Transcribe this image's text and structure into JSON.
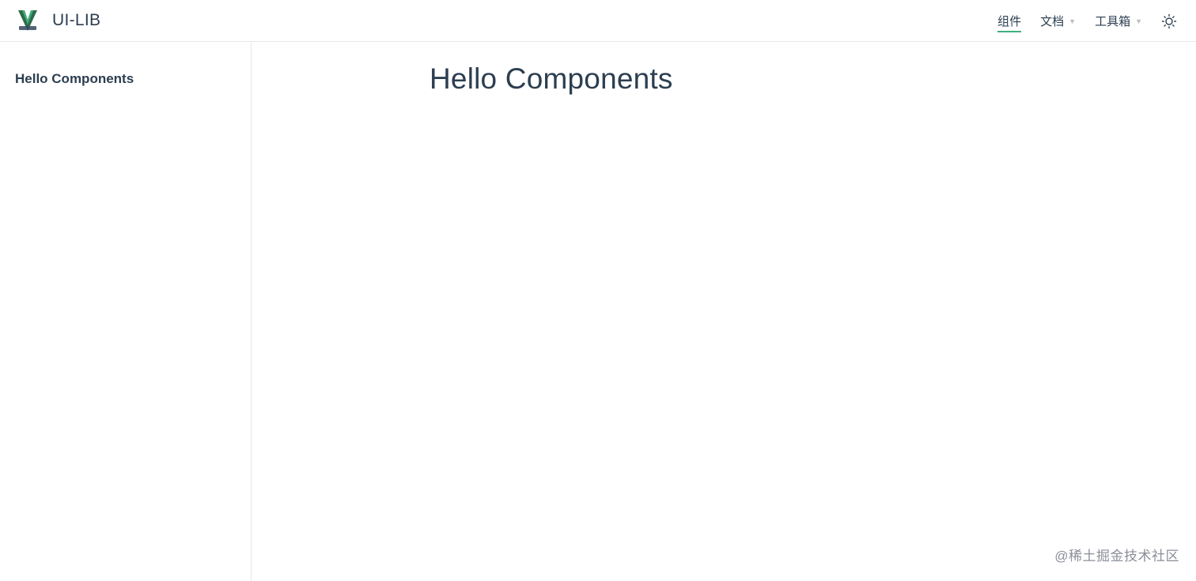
{
  "app": {
    "title": "UI-LIB",
    "logo_icon": "vue-like-logo-icon"
  },
  "nav": {
    "items": [
      {
        "label": "组件",
        "active": true,
        "has_dropdown": false
      },
      {
        "label": "文档",
        "active": false,
        "has_dropdown": true
      },
      {
        "label": "工具箱",
        "active": false,
        "has_dropdown": true
      }
    ],
    "caret_icon": "caret-down-icon",
    "theme_icon": "sun-icon"
  },
  "sidebar": {
    "items": [
      {
        "label": "Hello Components"
      }
    ]
  },
  "main": {
    "title": "Hello Components"
  },
  "watermark": {
    "text": "@稀土掘金技术社区"
  },
  "colors": {
    "accent": "#3eaf7c",
    "text": "#2c3e50",
    "border": "#e5e7eb"
  }
}
